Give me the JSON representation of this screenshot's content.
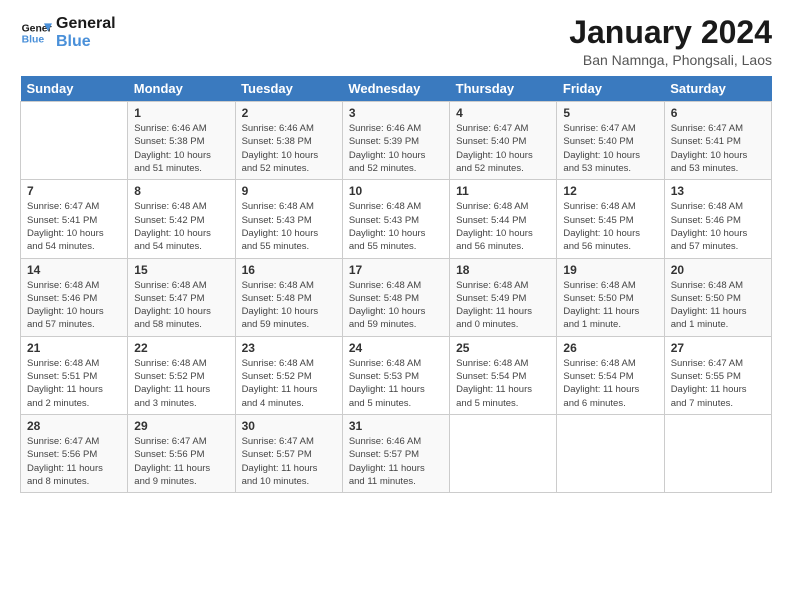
{
  "logo": {
    "line1": "General",
    "line2": "Blue"
  },
  "title": "January 2024",
  "subtitle": "Ban Namnga, Phongsali, Laos",
  "days_header": [
    "Sunday",
    "Monday",
    "Tuesday",
    "Wednesday",
    "Thursday",
    "Friday",
    "Saturday"
  ],
  "weeks": [
    [
      {
        "num": "",
        "info": ""
      },
      {
        "num": "1",
        "info": "Sunrise: 6:46 AM\nSunset: 5:38 PM\nDaylight: 10 hours\nand 51 minutes."
      },
      {
        "num": "2",
        "info": "Sunrise: 6:46 AM\nSunset: 5:38 PM\nDaylight: 10 hours\nand 52 minutes."
      },
      {
        "num": "3",
        "info": "Sunrise: 6:46 AM\nSunset: 5:39 PM\nDaylight: 10 hours\nand 52 minutes."
      },
      {
        "num": "4",
        "info": "Sunrise: 6:47 AM\nSunset: 5:40 PM\nDaylight: 10 hours\nand 52 minutes."
      },
      {
        "num": "5",
        "info": "Sunrise: 6:47 AM\nSunset: 5:40 PM\nDaylight: 10 hours\nand 53 minutes."
      },
      {
        "num": "6",
        "info": "Sunrise: 6:47 AM\nSunset: 5:41 PM\nDaylight: 10 hours\nand 53 minutes."
      }
    ],
    [
      {
        "num": "7",
        "info": "Sunrise: 6:47 AM\nSunset: 5:41 PM\nDaylight: 10 hours\nand 54 minutes."
      },
      {
        "num": "8",
        "info": "Sunrise: 6:48 AM\nSunset: 5:42 PM\nDaylight: 10 hours\nand 54 minutes."
      },
      {
        "num": "9",
        "info": "Sunrise: 6:48 AM\nSunset: 5:43 PM\nDaylight: 10 hours\nand 55 minutes."
      },
      {
        "num": "10",
        "info": "Sunrise: 6:48 AM\nSunset: 5:43 PM\nDaylight: 10 hours\nand 55 minutes."
      },
      {
        "num": "11",
        "info": "Sunrise: 6:48 AM\nSunset: 5:44 PM\nDaylight: 10 hours\nand 56 minutes."
      },
      {
        "num": "12",
        "info": "Sunrise: 6:48 AM\nSunset: 5:45 PM\nDaylight: 10 hours\nand 56 minutes."
      },
      {
        "num": "13",
        "info": "Sunrise: 6:48 AM\nSunset: 5:46 PM\nDaylight: 10 hours\nand 57 minutes."
      }
    ],
    [
      {
        "num": "14",
        "info": "Sunrise: 6:48 AM\nSunset: 5:46 PM\nDaylight: 10 hours\nand 57 minutes."
      },
      {
        "num": "15",
        "info": "Sunrise: 6:48 AM\nSunset: 5:47 PM\nDaylight: 10 hours\nand 58 minutes."
      },
      {
        "num": "16",
        "info": "Sunrise: 6:48 AM\nSunset: 5:48 PM\nDaylight: 10 hours\nand 59 minutes."
      },
      {
        "num": "17",
        "info": "Sunrise: 6:48 AM\nSunset: 5:48 PM\nDaylight: 10 hours\nand 59 minutes."
      },
      {
        "num": "18",
        "info": "Sunrise: 6:48 AM\nSunset: 5:49 PM\nDaylight: 11 hours\nand 0 minutes."
      },
      {
        "num": "19",
        "info": "Sunrise: 6:48 AM\nSunset: 5:50 PM\nDaylight: 11 hours\nand 1 minute."
      },
      {
        "num": "20",
        "info": "Sunrise: 6:48 AM\nSunset: 5:50 PM\nDaylight: 11 hours\nand 1 minute."
      }
    ],
    [
      {
        "num": "21",
        "info": "Sunrise: 6:48 AM\nSunset: 5:51 PM\nDaylight: 11 hours\nand 2 minutes."
      },
      {
        "num": "22",
        "info": "Sunrise: 6:48 AM\nSunset: 5:52 PM\nDaylight: 11 hours\nand 3 minutes."
      },
      {
        "num": "23",
        "info": "Sunrise: 6:48 AM\nSunset: 5:52 PM\nDaylight: 11 hours\nand 4 minutes."
      },
      {
        "num": "24",
        "info": "Sunrise: 6:48 AM\nSunset: 5:53 PM\nDaylight: 11 hours\nand 5 minutes."
      },
      {
        "num": "25",
        "info": "Sunrise: 6:48 AM\nSunset: 5:54 PM\nDaylight: 11 hours\nand 5 minutes."
      },
      {
        "num": "26",
        "info": "Sunrise: 6:48 AM\nSunset: 5:54 PM\nDaylight: 11 hours\nand 6 minutes."
      },
      {
        "num": "27",
        "info": "Sunrise: 6:47 AM\nSunset: 5:55 PM\nDaylight: 11 hours\nand 7 minutes."
      }
    ],
    [
      {
        "num": "28",
        "info": "Sunrise: 6:47 AM\nSunset: 5:56 PM\nDaylight: 11 hours\nand 8 minutes."
      },
      {
        "num": "29",
        "info": "Sunrise: 6:47 AM\nSunset: 5:56 PM\nDaylight: 11 hours\nand 9 minutes."
      },
      {
        "num": "30",
        "info": "Sunrise: 6:47 AM\nSunset: 5:57 PM\nDaylight: 11 hours\nand 10 minutes."
      },
      {
        "num": "31",
        "info": "Sunrise: 6:46 AM\nSunset: 5:57 PM\nDaylight: 11 hours\nand 11 minutes."
      },
      {
        "num": "",
        "info": ""
      },
      {
        "num": "",
        "info": ""
      },
      {
        "num": "",
        "info": ""
      }
    ]
  ]
}
